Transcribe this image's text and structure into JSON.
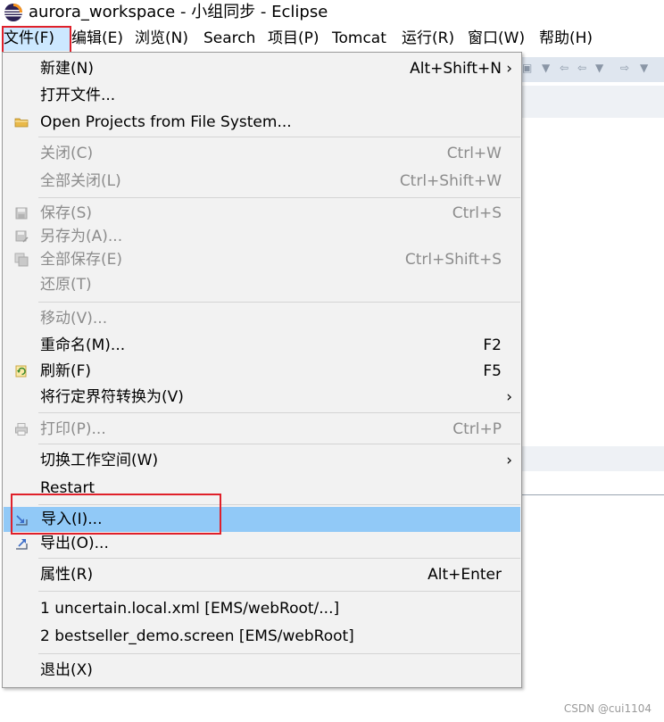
{
  "window": {
    "title": "aurora_workspace - 小组同步 - Eclipse"
  },
  "menubar": [
    {
      "label": "文件(F)",
      "active": true
    },
    {
      "label": "编辑(E)"
    },
    {
      "label": "浏览(N)"
    },
    {
      "label": "Search"
    },
    {
      "label": "项目(P)"
    },
    {
      "label": "Tomcat"
    },
    {
      "label": "运行(R)"
    },
    {
      "label": "窗口(W)"
    },
    {
      "label": "帮助(H)"
    }
  ],
  "file_menu": {
    "items": [
      {
        "label": "新建(N)",
        "accel": "Alt+Shift+N",
        "submenu": true
      },
      {
        "label": "打开文件..."
      },
      {
        "label": "Open Projects from File System...",
        "icon": "folder-icon"
      },
      {
        "label": "关闭(C)",
        "accel": "Ctrl+W",
        "disabled": true
      },
      {
        "label": "全部关闭(L)",
        "accel": "Ctrl+Shift+W",
        "disabled": true
      },
      {
        "label": "保存(S)",
        "accel": "Ctrl+S",
        "disabled": true,
        "icon": "save-icon"
      },
      {
        "label": "另存为(A)...",
        "disabled": true,
        "icon": "save-as-icon"
      },
      {
        "label": "全部保存(E)",
        "accel": "Ctrl+Shift+S",
        "disabled": true,
        "icon": "save-all-icon"
      },
      {
        "label": "还原(T)",
        "disabled": true
      },
      {
        "label": "移动(V)...",
        "disabled": true
      },
      {
        "label": "重命名(M)...",
        "accel": "F2"
      },
      {
        "label": "刷新(F)",
        "accel": "F5",
        "icon": "refresh-icon"
      },
      {
        "label": "将行定界符转换为(V)",
        "submenu": true
      },
      {
        "label": "打印(P)...",
        "accel": "Ctrl+P",
        "disabled": true,
        "icon": "print-icon"
      },
      {
        "label": "切换工作空间(W)",
        "submenu": true
      },
      {
        "label": "Restart"
      },
      {
        "label": "导入(I)...",
        "selected": true,
        "icon": "import-icon"
      },
      {
        "label": "导出(O)...",
        "icon": "export-icon"
      },
      {
        "label": "属性(R)",
        "accel": "Alt+Enter"
      },
      {
        "label": "1 uncertain.local.xml  [EMS/webRoot/...]"
      },
      {
        "label": "2 bestseller_demo.screen  [EMS/webRoot]"
      },
      {
        "label": "退出(X)"
      }
    ],
    "submenu_arrow": "›"
  },
  "watermark": "CSDN @cui1104",
  "colors": {
    "selected_row": "#91c9f7",
    "active_menu": "#cce8ff",
    "highlight_box": "#e0202a",
    "menu_bg": "#f2f2f2",
    "disabled_text": "#8c8c8c"
  }
}
